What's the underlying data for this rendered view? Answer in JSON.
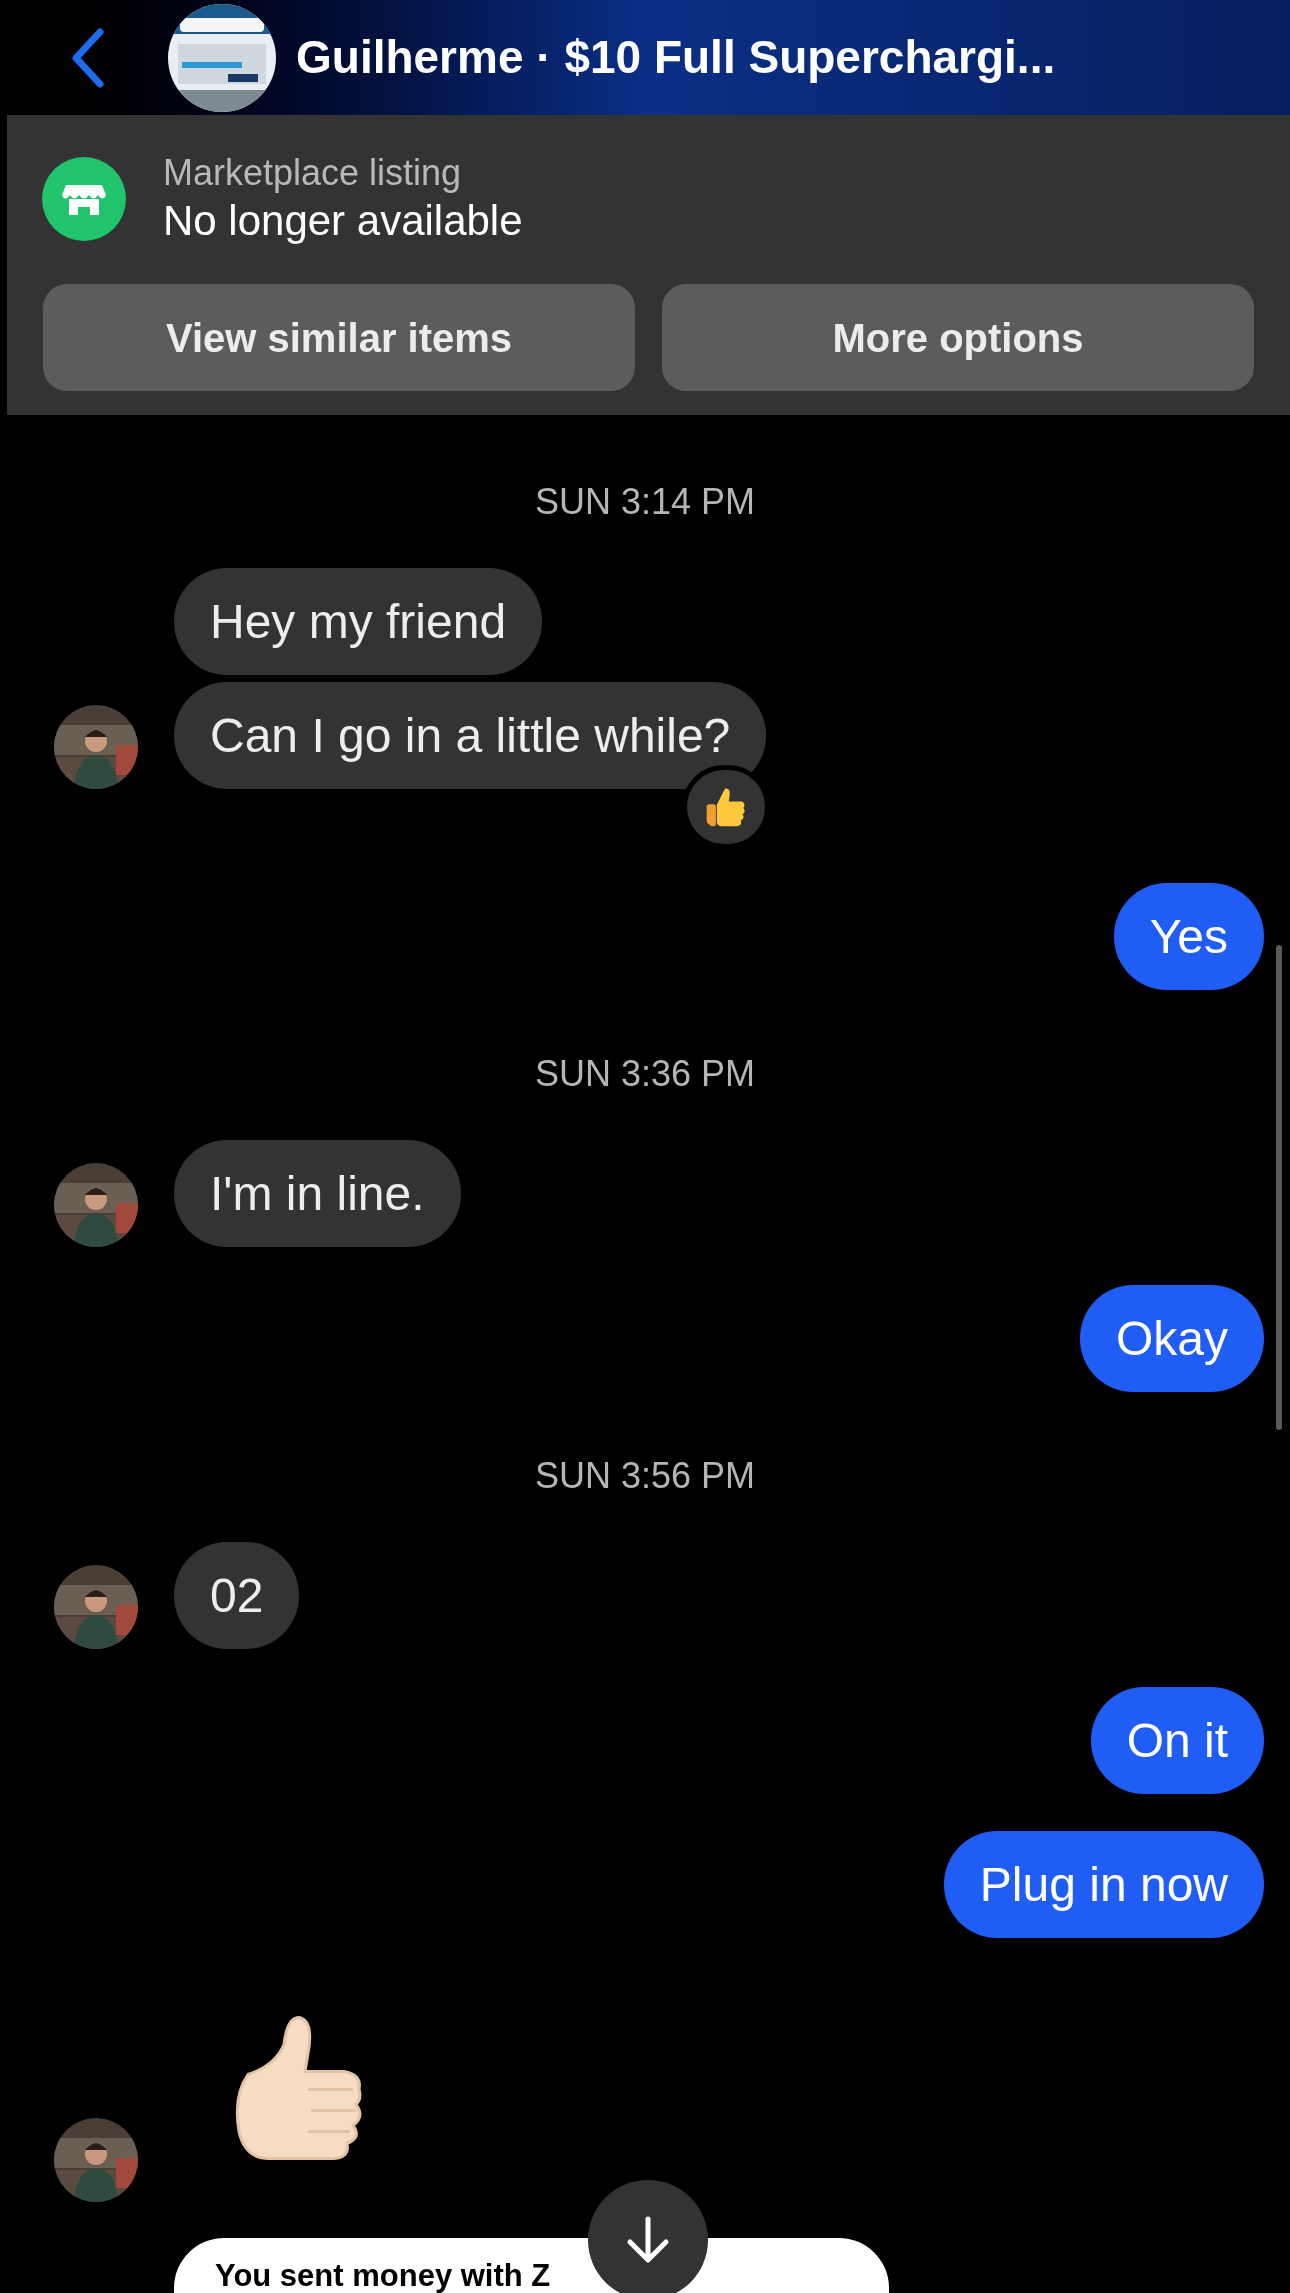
{
  "header": {
    "title": "Guilherme · $10 Full Superchargi..."
  },
  "listing": {
    "label": "Marketplace listing",
    "status": "No longer available",
    "buttons": [
      "View similar items",
      "More options"
    ]
  },
  "messages": [
    {
      "kind": "timestamp",
      "text": "SUN 3:14 PM"
    },
    {
      "kind": "incoming",
      "text": "Hey my friend",
      "avatar": false,
      "reacted": false
    },
    {
      "kind": "incoming",
      "text": "Can I go in a little while?",
      "avatar": true,
      "reacted": true
    },
    {
      "kind": "outgoing",
      "text": "Yes"
    },
    {
      "kind": "timestamp",
      "text": "SUN 3:36 PM"
    },
    {
      "kind": "incoming",
      "text": "I'm in line.",
      "avatar": true,
      "reacted": false
    },
    {
      "kind": "outgoing",
      "text": "Okay"
    },
    {
      "kind": "timestamp",
      "text": "SUN 3:56 PM"
    },
    {
      "kind": "incoming",
      "text": "02",
      "avatar": true,
      "reacted": false
    },
    {
      "kind": "outgoing",
      "text": "On it"
    },
    {
      "kind": "outgoing",
      "text": "Plug in now"
    },
    {
      "kind": "sticker",
      "avatar": true
    },
    {
      "kind": "payment",
      "text": "You sent money with Z"
    }
  ]
}
